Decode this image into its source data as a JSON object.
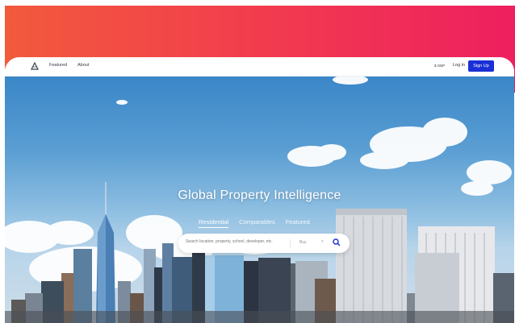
{
  "nav": {
    "links": [
      "Featured",
      "About"
    ],
    "currency": "GBP",
    "login": "Log in",
    "signup": "Sign Up"
  },
  "hero": {
    "title": "Global Property Intelligence",
    "tabs": [
      "Residential",
      "Comparables",
      "Featured"
    ],
    "active_tab": "Residential",
    "search": {
      "placeholder": "Search location, property, school, developer, etc.",
      "mode": "Buy"
    }
  },
  "colors": {
    "accent": "#1a2fd6",
    "gradient_start": "#f25a3c",
    "gradient_end": "#ee1f5f"
  },
  "icons": {
    "logo": "triangle-logo-icon",
    "currency": "currency-icon",
    "mode_dropdown": "chevron-down-icon",
    "search": "search-icon"
  }
}
